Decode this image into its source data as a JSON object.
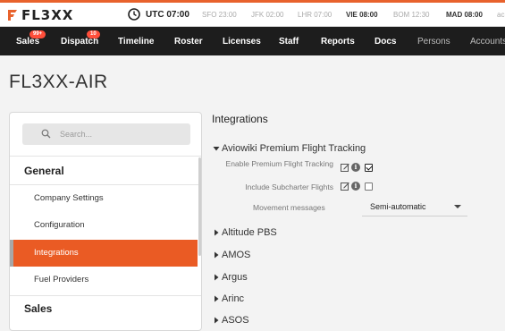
{
  "brand": {
    "logo_text": "FL3XX",
    "accent": "#e8622c"
  },
  "clock": {
    "utc": "UTC 07:00",
    "timezones": [
      {
        "label": "SFO 23:00",
        "active": false
      },
      {
        "label": "JFK 02:00",
        "active": false
      },
      {
        "label": "LHR 07:00",
        "active": false
      },
      {
        "label": "VIE 08:00",
        "active": true
      },
      {
        "label": "BOM 12:30",
        "active": false
      },
      {
        "label": "MAD 08:00",
        "active": true
      },
      {
        "label": "ac",
        "active": false
      }
    ]
  },
  "nav": {
    "items": [
      {
        "label": "Sales",
        "badge": "99+"
      },
      {
        "label": "Dispatch",
        "badge": "10"
      },
      {
        "label": "Timeline"
      },
      {
        "label": "Roster"
      },
      {
        "label": "Licenses"
      },
      {
        "label": "Staff"
      },
      {
        "label": "Reports"
      },
      {
        "label": "Docs"
      },
      {
        "label": "Persons"
      },
      {
        "label": "Accounts"
      }
    ]
  },
  "page": {
    "title": "FL3XX-AIR"
  },
  "sidebar": {
    "search_placeholder": "Search...",
    "groups": [
      {
        "title": "General",
        "items": [
          "Company Settings",
          "Configuration",
          "Integrations",
          "Fuel Providers"
        ]
      },
      {
        "title": "Sales"
      }
    ],
    "active_item": "Integrations"
  },
  "main": {
    "section_title": "Integrations",
    "aviowiki": {
      "title": "Aviowiki Premium Flight Tracking",
      "expanded": true,
      "settings": [
        {
          "label": "Enable Premium Flight Tracking",
          "checked": true
        },
        {
          "label": "Include Subcharter Flights",
          "checked": false
        }
      ],
      "movement_label": "Movement messages",
      "movement_value": "Semi-automatic"
    },
    "integrations": [
      "Altitude PBS",
      "AMOS",
      "Argus",
      "Arinc",
      "ASOS"
    ]
  }
}
